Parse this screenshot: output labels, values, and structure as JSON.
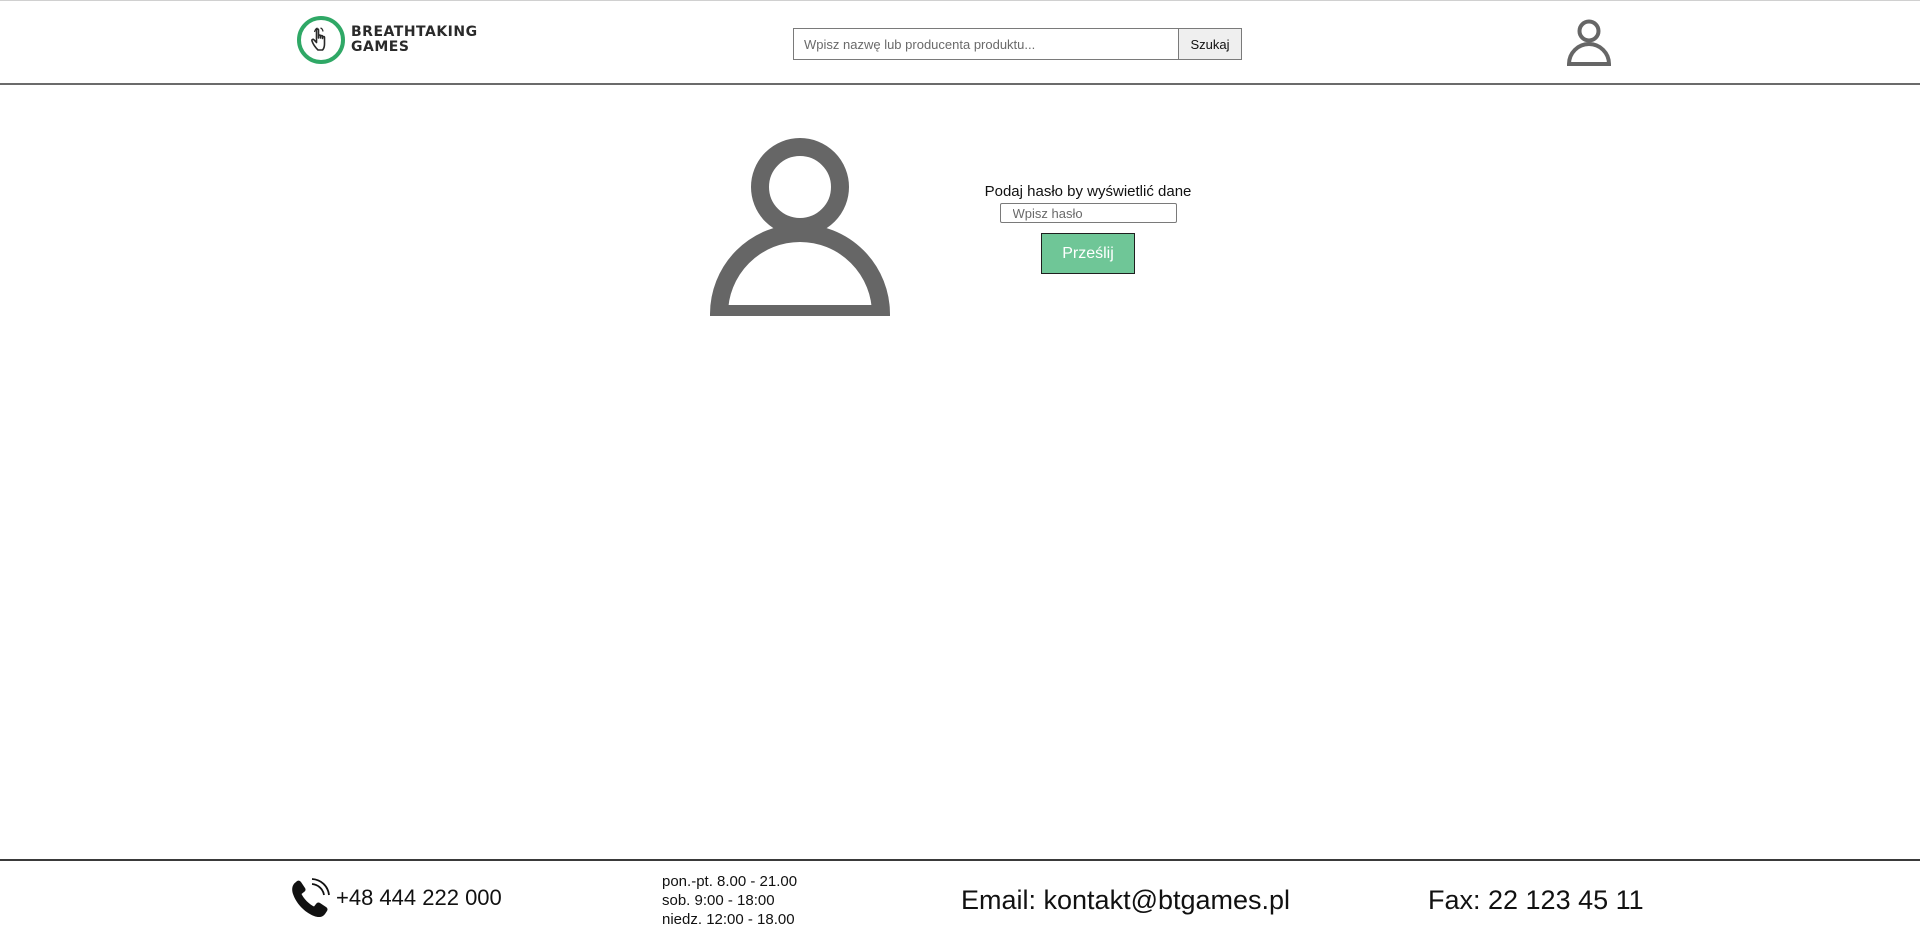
{
  "header": {
    "logo": {
      "line1": "BREATHTAKING",
      "line2": "GAMES",
      "icon": "hand-pointer-icon",
      "accent_color": "#2fa866"
    },
    "search": {
      "placeholder": "Wpisz nazwę lub producenta produktu...",
      "value": "",
      "button_label": "Szukaj"
    },
    "account_icon": "user-icon"
  },
  "main": {
    "avatar_icon": "user-avatar-icon",
    "prompt_label": "Podaj hasło by wyświetlić dane",
    "password": {
      "placeholder": "Wpisz hasło",
      "value": ""
    },
    "submit_label": "Prześlij",
    "submit_color": "#6fc697",
    "icon_color": "#666666"
  },
  "footer": {
    "phone_icon": "phone-icon",
    "phone": "+48 444 222 000",
    "hours": [
      "pon.-pt. 8.00 - 21.00",
      "sob. 9:00 - 18:00",
      "niedz. 12:00 - 18.00"
    ],
    "email": "Email: kontakt@btgames.pl",
    "fax": "Fax: 22 123 45 11"
  }
}
